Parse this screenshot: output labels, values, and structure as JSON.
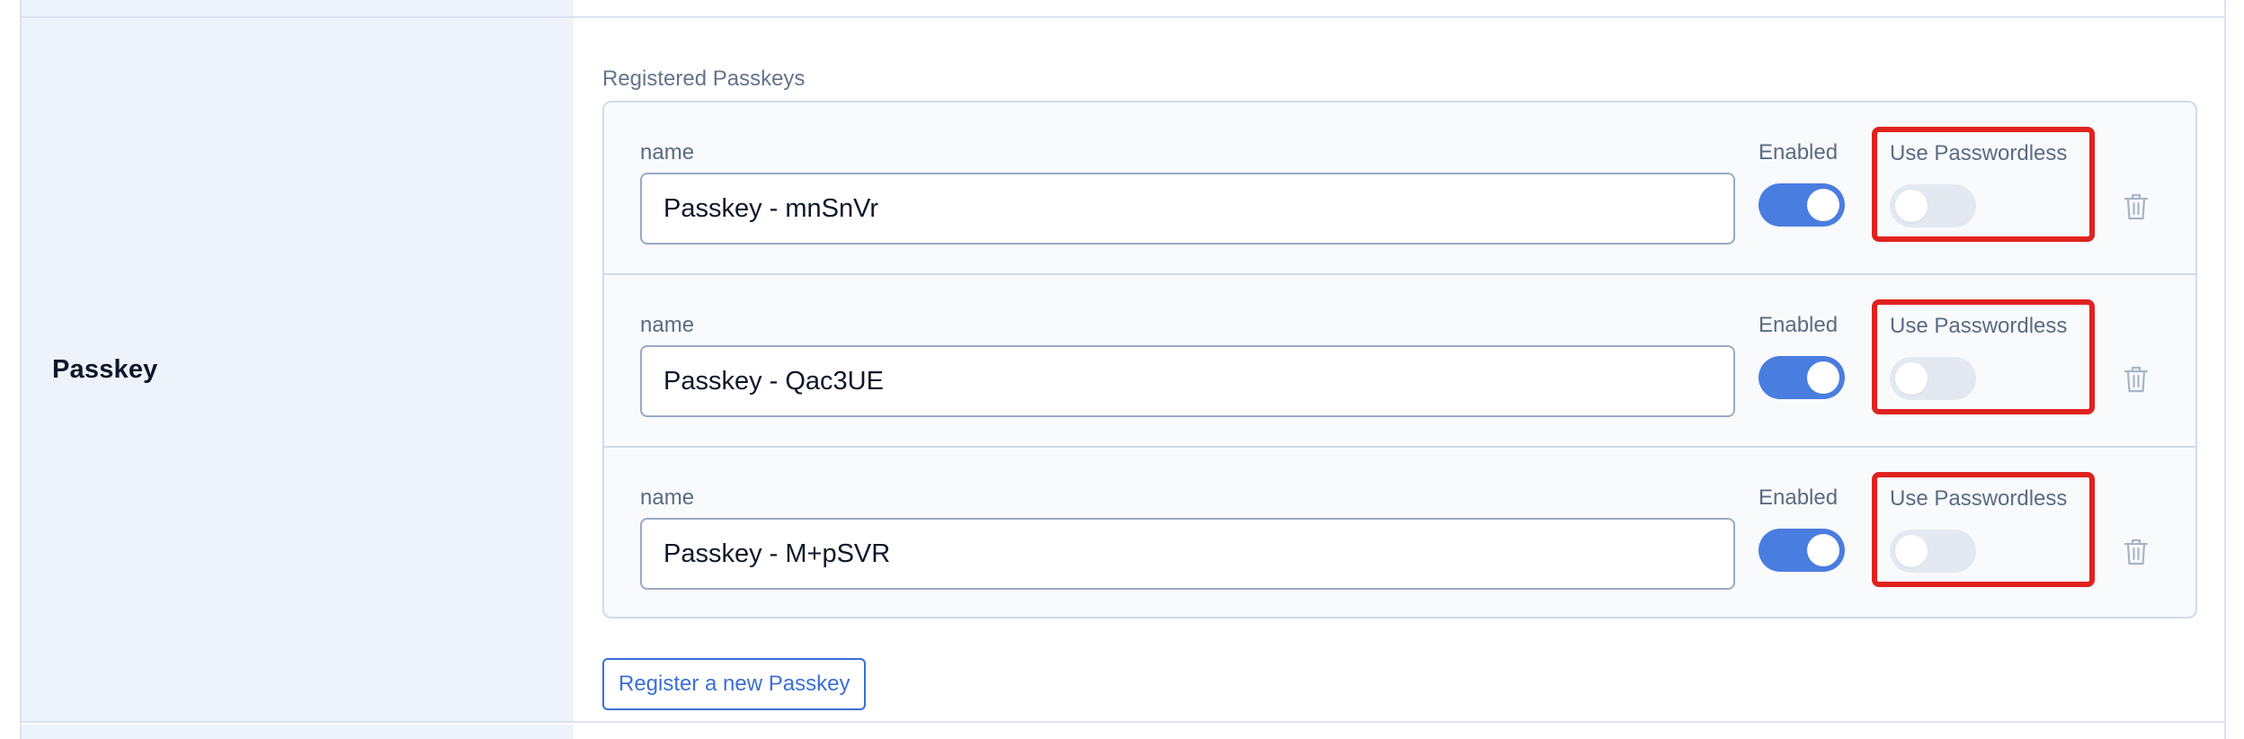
{
  "section": {
    "title": "Passkey",
    "list_label": "Registered Passkeys"
  },
  "passkeys": [
    {
      "name_label": "name",
      "name_value": "Passkey - mnSnVr",
      "enabled_label": "Enabled",
      "enabled": true,
      "passwordless_label": "Use Passwordless",
      "passwordless": false
    },
    {
      "name_label": "name",
      "name_value": "Passkey - Qac3UE",
      "enabled_label": "Enabled",
      "enabled": true,
      "passwordless_label": "Use Passwordless",
      "passwordless": false
    },
    {
      "name_label": "name",
      "name_value": "Passkey - M+pSVR",
      "enabled_label": "Enabled",
      "enabled": true,
      "passwordless_label": "Use Passwordless",
      "passwordless": false
    }
  ],
  "actions": {
    "register_label": "Register a new Passkey"
  },
  "colors": {
    "accent": "#4a7de0",
    "highlight": "#e0221f",
    "toggle_off": "#e4e9f1",
    "sidebar_bg": "#eef2fa"
  },
  "icons": {
    "delete": "trash-icon"
  }
}
